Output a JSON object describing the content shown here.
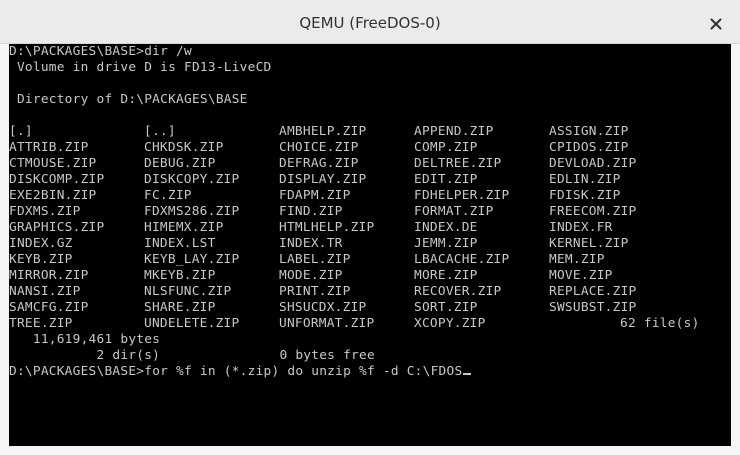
{
  "window": {
    "title": "QEMU (FreeDOS-0)",
    "close_icon": "close-icon"
  },
  "console": {
    "lines_before": [
      "D:\\PACKAGES\\BASE>dir /w",
      " Volume in drive D is FD13-LiveCD",
      "",
      " Directory of D:\\PACKAGES\\BASE",
      ""
    ],
    "file_rows": [
      [
        "[.]",
        "[..]",
        "AMBHELP.ZIP",
        "APPEND.ZIP",
        "ASSIGN.ZIP"
      ],
      [
        "ATTRIB.ZIP",
        "CHKDSK.ZIP",
        "CHOICE.ZIP",
        "COMP.ZIP",
        "CPIDOS.ZIP"
      ],
      [
        "CTMOUSE.ZIP",
        "DEBUG.ZIP",
        "DEFRAG.ZIP",
        "DELTREE.ZIP",
        "DEVLOAD.ZIP"
      ],
      [
        "DISKCOMP.ZIP",
        "DISKCOPY.ZIP",
        "DISPLAY.ZIP",
        "EDIT.ZIP",
        "EDLIN.ZIP"
      ],
      [
        "EXE2BIN.ZIP",
        "FC.ZIP",
        "FDAPM.ZIP",
        "FDHELPER.ZIP",
        "FDISK.ZIP"
      ],
      [
        "FDXMS.ZIP",
        "FDXMS286.ZIP",
        "FIND.ZIP",
        "FORMAT.ZIP",
        "FREECOM.ZIP"
      ],
      [
        "GRAPHICS.ZIP",
        "HIMEMX.ZIP",
        "HTMLHELP.ZIP",
        "INDEX.DE",
        "INDEX.FR"
      ],
      [
        "INDEX.GZ",
        "INDEX.LST",
        "INDEX.TR",
        "JEMM.ZIP",
        "KERNEL.ZIP"
      ],
      [
        "KEYB.ZIP",
        "KEYB_LAY.ZIP",
        "LABEL.ZIP",
        "LBACACHE.ZIP",
        "MEM.ZIP"
      ],
      [
        "MIRROR.ZIP",
        "MKEYB.ZIP",
        "MODE.ZIP",
        "MORE.ZIP",
        "MOVE.ZIP"
      ],
      [
        "NANSI.ZIP",
        "NLSFUNC.ZIP",
        "PRINT.ZIP",
        "RECOVER.ZIP",
        "REPLACE.ZIP"
      ],
      [
        "SAMCFG.ZIP",
        "SHARE.ZIP",
        "SHSUCDX.ZIP",
        "SORT.ZIP",
        "SWSUBST.ZIP"
      ],
      [
        "TREE.ZIP",
        "UNDELETE.ZIP",
        "UNFORMAT.ZIP",
        "XCOPY.ZIP",
        ""
      ]
    ],
    "file_count": "62 file(s)",
    "lines_after": [
      "   11,619,461 bytes",
      "           2 dir(s)               0 bytes free"
    ],
    "prompt": "D:\\PACKAGES\\BASE>",
    "command": "for %f in (*.zip) do unzip %f -d C:\\FDOS"
  }
}
